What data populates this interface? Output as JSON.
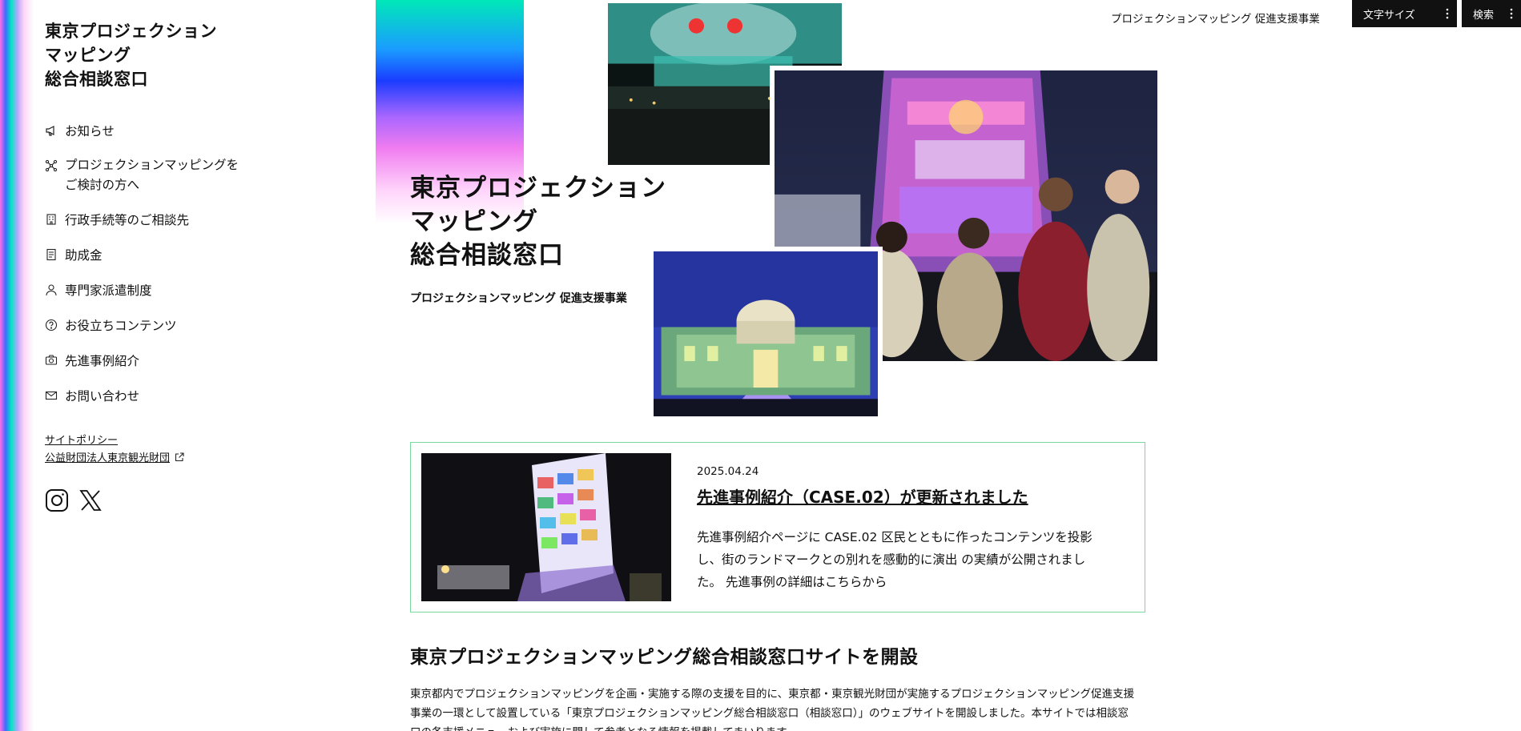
{
  "sidebar": {
    "site_title": "東京プロジェクション\nマッピング\n総合相談窓口",
    "site_title_lines": [
      "東京プロジェクション",
      "マッピング",
      "総合相談窓口"
    ],
    "nav": [
      {
        "label": "お知らせ",
        "icon": "megaphone-icon"
      },
      {
        "label": "プロジェクションマッピングを\nご検討の方へ",
        "icon": "network-icon"
      },
      {
        "label": "行政手続等のご相談先",
        "icon": "building-icon"
      },
      {
        "label": "助成金",
        "icon": "document-icon"
      },
      {
        "label": "専門家派遣制度",
        "icon": "person-icon"
      },
      {
        "label": "お役立ちコンテンツ",
        "icon": "question-circle-icon"
      },
      {
        "label": "先進事例紹介",
        "icon": "camera-icon"
      },
      {
        "label": "お問い合わせ",
        "icon": "mail-icon"
      }
    ],
    "links": {
      "policy": "サイトポリシー",
      "foundation": "公益財団法人東京観光財団"
    },
    "social": [
      "instagram-icon",
      "x-icon"
    ]
  },
  "header": {
    "tagline": "プロジェクションマッピング 促進支援事業",
    "font_size_button": "文字サイズ",
    "search_button": "検索"
  },
  "hero": {
    "title_lines": [
      "東京プロジェクション",
      "マッピング",
      "総合相談窓口"
    ],
    "subtitle": "プロジェクションマッピング 促進支援事業"
  },
  "news": {
    "date": "2025.04.24",
    "title": "先進事例紹介（CASE.02）が更新されました",
    "body": "先進事例紹介ページに CASE.02 区民とともに作ったコンテンツを投影し、街のランドマークとの別れを感動的に演出 の実績が公開されました。 先進事例の詳細はこちらから"
  },
  "section": {
    "title": "東京プロジェクションマッピング総合相談窓口サイトを開設",
    "body": "東京都内でプロジェクションマッピングを企画・実施する際の支援を目的に、東京都・東京観光財団が実施するプロジェクションマッピング促進支援事業の一環として設置している「東京プロジェクションマッピング総合相談窓口（相談窓口）」のウェブサイトを開設しました。本サイトでは相談窓口の各支援メニューおよび実施に関して参考となる情報を掲載してまいります。"
  },
  "colors": {
    "accent_border": "#78d99f",
    "dark_button": "#111111"
  }
}
